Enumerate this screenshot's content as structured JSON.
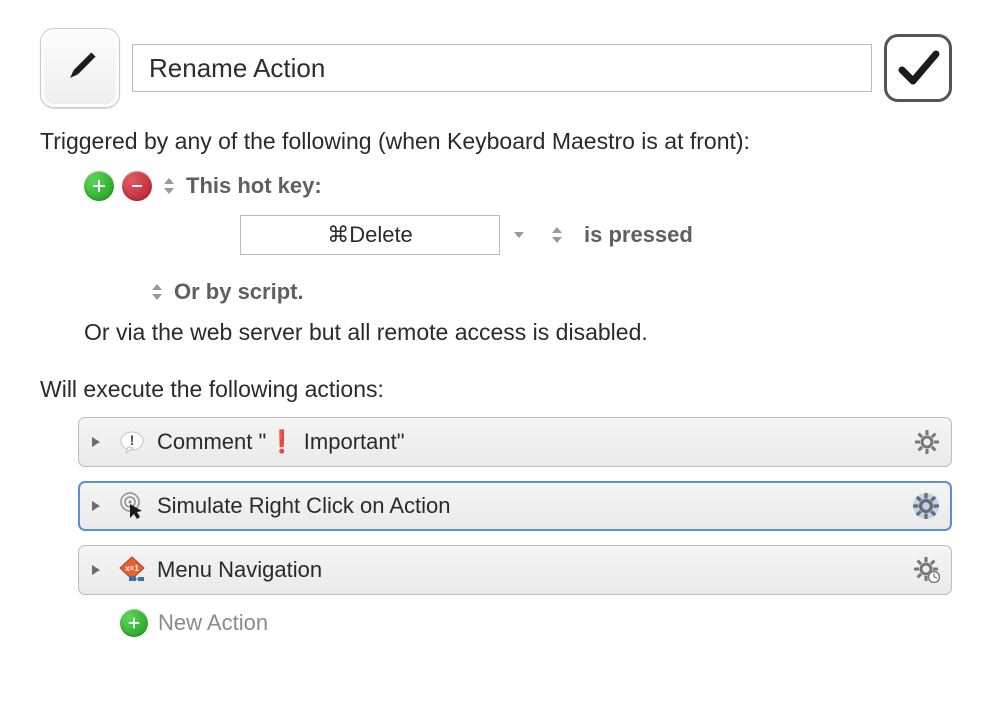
{
  "header": {
    "title": "Rename Action"
  },
  "trigger": {
    "header": "Triggered by any of the following (when Keyboard Maestro is at front):",
    "hotkey_label": "This hot key:",
    "hotkey_value": "⌘Delete",
    "pressed_label": "is pressed",
    "or_script": "Or by script.",
    "webserver": "Or via the web server but all remote access is disabled."
  },
  "exec_header": "Will execute the following actions:",
  "actions": [
    {
      "title_pre": "Comment \"",
      "title_mark": "❗",
      "title_post": " Important\""
    },
    {
      "title": "Simulate Right Click on Action"
    },
    {
      "title": "Menu Navigation"
    }
  ],
  "new_action_label": "New Action"
}
